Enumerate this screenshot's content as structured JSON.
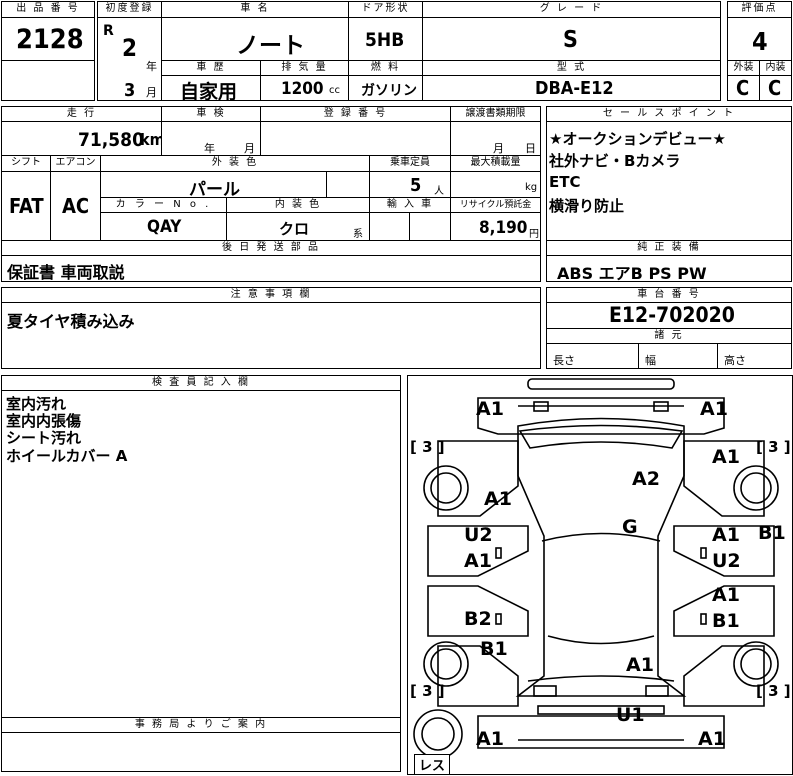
{
  "header": {
    "lot_no_label": "出 品 番 号",
    "lot_no": "2128",
    "first_reg_label": "初度登録",
    "era": "R",
    "year": "2",
    "year_unit": "年",
    "month": "3",
    "month_unit": "月",
    "car_name_label": "車 名",
    "car_name": "ノート",
    "door_label": "ドア形状",
    "door": "5HB",
    "grade_label": "グ レ ー ド",
    "grade": "S",
    "score_label": "評価点",
    "score": "4",
    "usage_label": "車 歴",
    "usage": "自家用",
    "displacement_label": "排 気 量",
    "displacement": "1200",
    "displacement_unit": "cc",
    "fuel_label": "燃 料",
    "fuel": "ガソリン",
    "model_label": "型 式",
    "model": "DBA-E12",
    "ext_label": "外装",
    "ext": "C",
    "int_label": "内装",
    "int": "C"
  },
  "row2": {
    "mileage_label": "走 行",
    "mileage": "71,580",
    "mileage_unit": "km",
    "inspection_label": "車 検",
    "insp_year_unit": "年",
    "insp_month_unit": "月",
    "regno_label": "登 録 番 号",
    "transfer_label": "譲渡書類期限",
    "transfer_month": "月",
    "transfer_day": "日",
    "selling_label": "セ ー ル ス ポ イ ン ト",
    "selling_points": [
      "★オークションデビュー★",
      "社外ナビ・Bカメラ",
      "ETC",
      "横滑り防止"
    ]
  },
  "row3": {
    "shift_label": "シフト",
    "shift": "FAT",
    "ac_label": "エアコン",
    "ac": "AC",
    "color_label": "外 装 色",
    "color": "パール",
    "capacity_label": "乗車定員",
    "capacity": "5",
    "capacity_unit": "人",
    "load_label": "最大積載量",
    "load_unit": "kg",
    "colorno_label": "カ ラ ー N o .",
    "colorno": "QAY",
    "intcolor_label": "内 装 色",
    "intcolor": "クロ",
    "intcolor_unit": "系",
    "import_label": "輸 入 車",
    "recycle_label": "リサイクル預託金",
    "recycle": "8,190",
    "recycle_unit": "円"
  },
  "parts": {
    "label": "後 日 発 送 部 品",
    "value": "保証書 車両取説"
  },
  "equipment": {
    "label": "純 正 装 備",
    "value": "ABS エアB PS PW"
  },
  "notes": {
    "label": "注 意 事 項 欄",
    "value": "夏タイヤ積み込み"
  },
  "chassis": {
    "label": "車 台 番 号",
    "value": "E12-702020"
  },
  "dims": {
    "label": "諸 元",
    "length": "長さ",
    "width": "幅",
    "height": "高さ"
  },
  "inspector": {
    "label": "検 査 員 記 入 欄",
    "lines": [
      "室内汚れ",
      "室内内張傷",
      "シート汚れ",
      "ホイールカバー A"
    ]
  },
  "office": {
    "label": "事 務 局 よ り ご 案 内"
  },
  "diagram": {
    "marks": [
      "A1",
      "A1",
      "A1",
      "A1",
      "A2",
      "A1",
      "G",
      "U2",
      "A1",
      "U2",
      "A1",
      "B1",
      "A1",
      "B2",
      "B1",
      "B1",
      "A1",
      "U1",
      "A1",
      "A1"
    ],
    "tread": [
      "[ 3 ]",
      "[ 3 ]",
      "[ 3 ]",
      "[ 3 ]"
    ],
    "spare": "レス"
  }
}
